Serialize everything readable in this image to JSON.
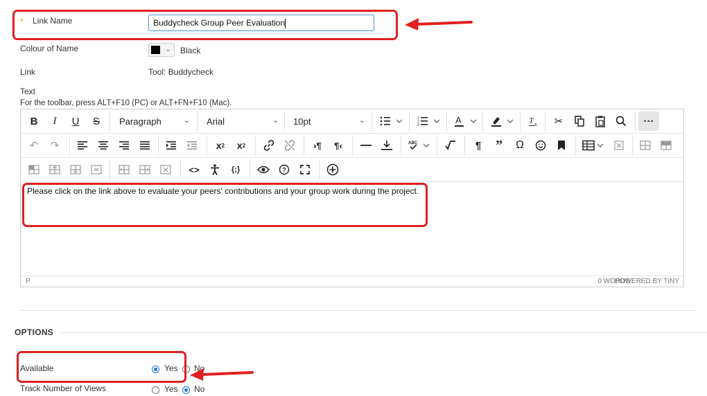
{
  "form": {
    "link_name": {
      "required_mark": "*",
      "label": "Link Name",
      "value": "Buddycheck Group Peer Evaluation"
    },
    "colour": {
      "label": "Colour of Name",
      "value": "Black",
      "swatch": "#000000"
    },
    "link": {
      "label": "Link",
      "value": "Tool: Buddycheck"
    },
    "text": {
      "label": "Text",
      "hint": "For the toolbar, press ALT+F10 (PC) or ALT+FN+F10 (Mac)."
    }
  },
  "editor": {
    "block_format": "Paragraph",
    "font_family": "Arial",
    "font_size": "10pt",
    "content": "Please click on the link above to evaluate your peers' contributions and your group work during the project.",
    "path": "P",
    "word_count": "0 WORDS",
    "powered_by": "POWERED BY TINY"
  },
  "options": {
    "heading": "OPTIONS",
    "available": {
      "label": "Available",
      "yes": "Yes",
      "no": "No",
      "selected": "yes"
    },
    "track_views": {
      "label": "Track Number of Views",
      "yes": "Yes",
      "no": "No",
      "selected": "no"
    }
  },
  "colors": {
    "highlight": "#e02020",
    "accent": "#1a73d9",
    "required": "#e8a000"
  }
}
